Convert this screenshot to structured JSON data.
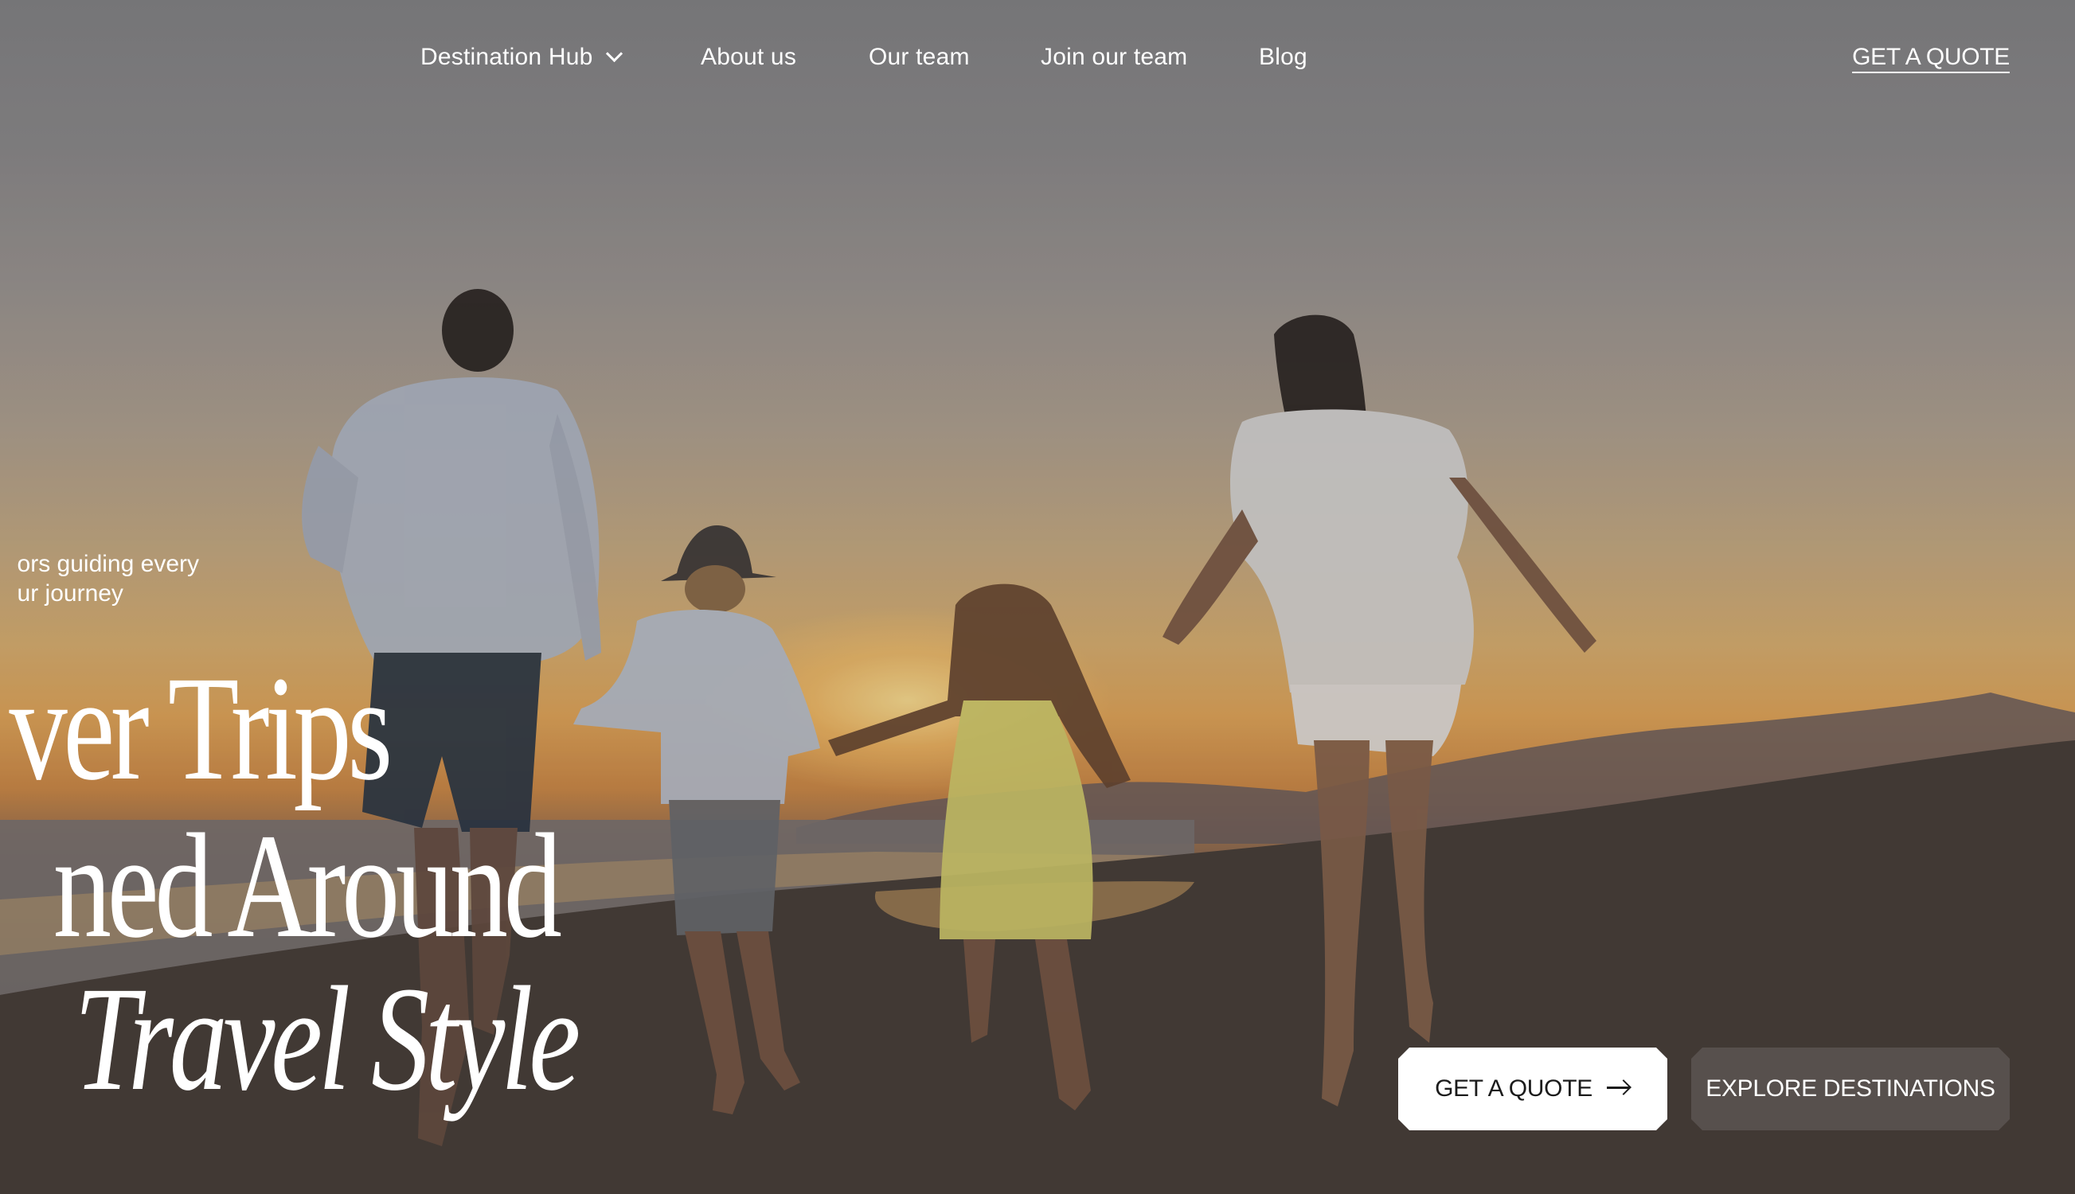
{
  "nav": {
    "items": [
      {
        "label": "Destination Hub",
        "has_dropdown": true
      },
      {
        "label": "About us"
      },
      {
        "label": "Our team"
      },
      {
        "label": "Join our team"
      },
      {
        "label": "Blog"
      }
    ],
    "cta_label": "GET A QUOTE"
  },
  "hero": {
    "tagline_line1": "ors guiding every",
    "tagline_line2": "ur journey",
    "headline_line1": "ver Trips",
    "headline_line2": "ned Around",
    "headline_line3": "Travel Style"
  },
  "buttons": {
    "quote_label": "GET A QUOTE",
    "quote_icon": "arrow-right-icon",
    "explore_label": "EXPLORE DESTINATIONS"
  },
  "colors": {
    "text_primary": "#ffffff",
    "button_light_bg": "#ffffff",
    "button_dark_bg": "#57504d",
    "button_dark_text": "#1b1b1b"
  }
}
